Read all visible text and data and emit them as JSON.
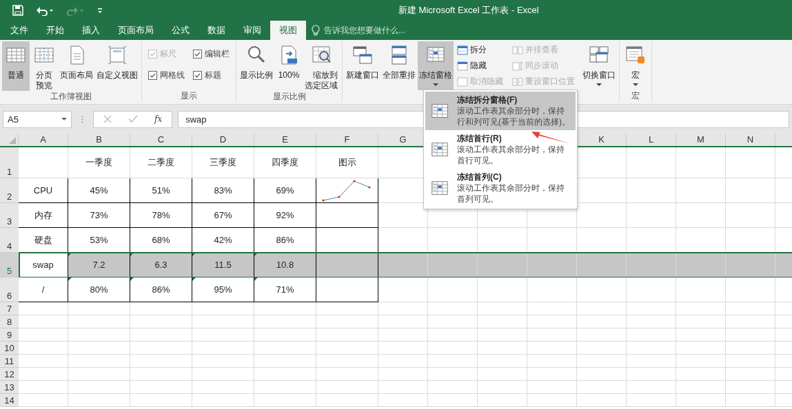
{
  "title_bar": {
    "title": "新建 Microsoft Excel 工作表 - Excel",
    "quick_access": [
      {
        "kind": "save",
        "disabled": false
      },
      {
        "kind": "undo",
        "disabled": false
      },
      {
        "kind": "redo",
        "disabled": true
      },
      {
        "kind": "customize",
        "disabled": false
      }
    ]
  },
  "tabs": [
    {
      "label": "文件",
      "selected": false
    },
    {
      "label": "开始",
      "selected": false
    },
    {
      "label": "插入",
      "selected": false
    },
    {
      "label": "页面布局",
      "selected": false
    },
    {
      "label": "公式",
      "selected": false
    },
    {
      "label": "数据",
      "selected": false
    },
    {
      "label": "审阅",
      "selected": false
    },
    {
      "label": "视图",
      "selected": true
    }
  ],
  "tell_me": {
    "placeholder": "告诉我您想要做什么..."
  },
  "ribbon": {
    "groups": [
      {
        "label": "工作簿视图",
        "items": [
          {
            "kind": "large",
            "label": "普通",
            "selected": true
          },
          {
            "kind": "large",
            "label": "分页预览",
            "selected": false
          },
          {
            "kind": "large",
            "label": "页面布局",
            "selected": false
          },
          {
            "kind": "large",
            "label": "自定义视图",
            "selected": false
          }
        ]
      },
      {
        "label": "显示",
        "items": [
          {
            "kind": "checks",
            "items": [
              {
                "label": "标尺",
                "checked": true,
                "disabled": true
              },
              {
                "label": "编辑栏",
                "checked": true,
                "disabled": false
              },
              {
                "label": "网格线",
                "checked": true,
                "disabled": false
              },
              {
                "label": "标题",
                "checked": true,
                "disabled": false
              }
            ]
          }
        ]
      },
      {
        "label": "显示比例",
        "items": [
          {
            "kind": "large",
            "label": "显示比例",
            "selected": false
          },
          {
            "kind": "large",
            "label": "100%",
            "selected": false
          },
          {
            "kind": "large",
            "label": "缩放到选定区域",
            "selected": false
          }
        ]
      },
      {
        "items": [
          {
            "kind": "large",
            "label": "新建窗口",
            "selected": false
          },
          {
            "kind": "large",
            "label": "全部重排",
            "selected": false
          },
          {
            "kind": "large",
            "label": "冻结窗格",
            "selected": true,
            "caret": true
          },
          {
            "kind": "stack",
            "items": [
              {
                "label": "拆分",
                "disabled": false
              },
              {
                "label": "隐藏",
                "disabled": false
              },
              {
                "label": "取消隐藏",
                "disabled": true
              }
            ]
          },
          {
            "kind": "stack",
            "items": [
              {
                "label": "并排查看",
                "disabled": true
              },
              {
                "label": "同步滚动",
                "disabled": true
              },
              {
                "label": "重设窗口位置",
                "disabled": true
              }
            ]
          },
          {
            "kind": "large",
            "label": "切换窗口",
            "selected": false,
            "caret": true
          }
        ]
      },
      {
        "label": "宏",
        "items": [
          {
            "kind": "large",
            "label": "宏",
            "selected": false,
            "caret": true
          }
        ]
      }
    ]
  },
  "formula_bar": {
    "name_box": "A5",
    "function_label": "fx",
    "value": "swap"
  },
  "sheet": {
    "columns": [
      {
        "label": "A"
      },
      {
        "label": "B"
      },
      {
        "label": "C"
      },
      {
        "label": "D"
      },
      {
        "label": "E"
      },
      {
        "label": "F"
      },
      {
        "label": "G"
      }
    ],
    "columns_right": [
      {
        "label": "K"
      },
      {
        "label": "L"
      },
      {
        "label": "M"
      },
      {
        "label": "N"
      }
    ],
    "rows": [
      {
        "number": "1",
        "selected": false,
        "cells": [
          null,
          "一季度",
          "二季度",
          "三季度",
          "四季度",
          "图示"
        ]
      },
      {
        "number": "2",
        "selected": false,
        "bordered": true,
        "cells": [
          "CPU",
          "45%",
          "51%",
          "83%",
          "69%",
          {
            "kind": "sparkline"
          }
        ]
      },
      {
        "number": "3",
        "selected": false,
        "bordered": true,
        "cells": [
          "内存",
          "73%",
          "78%",
          "67%",
          "92%",
          null
        ]
      },
      {
        "number": "4",
        "selected": false,
        "bordered": true,
        "cells": [
          "硬盘",
          "53%",
          "68%",
          "42%",
          "86%",
          null
        ]
      },
      {
        "number": "5",
        "selected": true,
        "bordered": true,
        "warning_marks": true,
        "cells": [
          "swap",
          "7.2",
          "6.3",
          "11.5",
          "10.8",
          null
        ]
      },
      {
        "number": "6",
        "selected": false,
        "bordered": true,
        "warning_marks": true,
        "cells": [
          "/",
          "80%",
          "86%",
          "95%",
          "71%",
          null
        ]
      },
      {
        "number": "7",
        "selected": false
      },
      {
        "number": "8",
        "selected": false
      },
      {
        "number": "9",
        "selected": false
      },
      {
        "number": "10",
        "selected": false
      },
      {
        "number": "11",
        "selected": false
      },
      {
        "number": "12",
        "selected": false
      },
      {
        "number": "13",
        "selected": false
      },
      {
        "number": "14",
        "selected": false
      }
    ]
  },
  "freeze_menu": {
    "items": [
      {
        "title": "冻结拆分窗格(F)",
        "description": "滚动工作表其余部分时，保持行和列可见(基于当前的选择)。",
        "selected": true
      },
      {
        "title": "冻结首行(R)",
        "description": "滚动工作表其余部分时，保持首行可见。",
        "selected": false
      },
      {
        "title": "冻结首列(C)",
        "description": "滚动工作表其余部分时，保持首列可见。",
        "selected": false
      }
    ]
  }
}
